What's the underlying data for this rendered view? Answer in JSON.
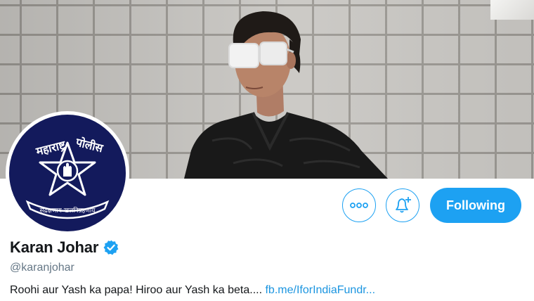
{
  "profile": {
    "display_name": "Karan Johar",
    "handle": "@karanjohar",
    "bio_text": "Roohi aur Yash ka papa! Hiroo aur Yash ka beta.... ",
    "bio_link": "fb.me/IforIndiaFundr...",
    "verified": true
  },
  "actions": {
    "following_label": "Following"
  },
  "avatar": {
    "top_text": "महाराष्ट्र पोलीस",
    "bottom_text": "सद्रक्षणाय खलनिग्रहणाय"
  },
  "colors": {
    "accent": "#1da1f2",
    "link": "#1b95e0",
    "avatar_bg": "#131a5c"
  }
}
